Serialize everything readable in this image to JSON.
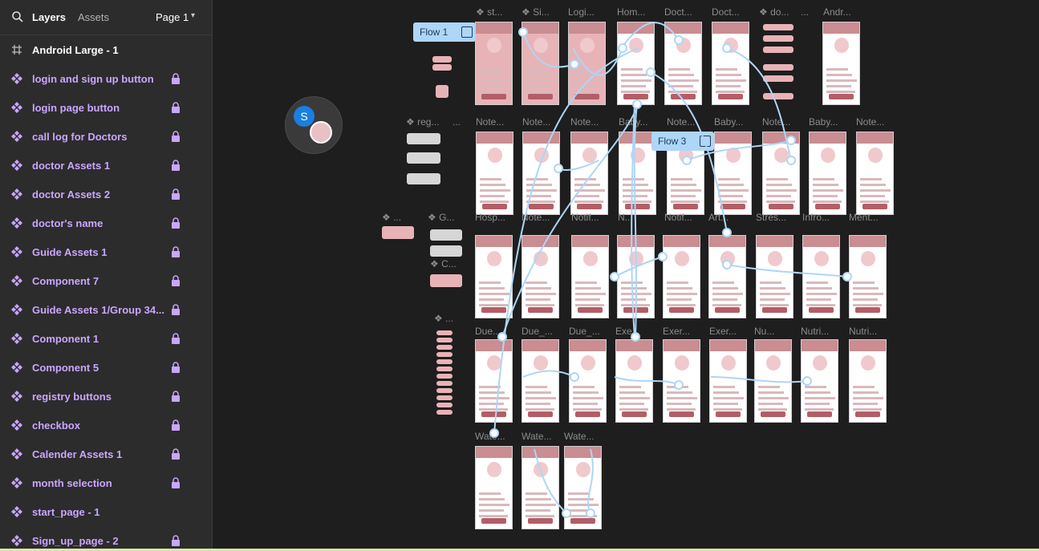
{
  "sidebar": {
    "tab_layers": "Layers",
    "tab_assets": "Assets",
    "page_selector": "Page 1",
    "frame_name": "Android Large - 1",
    "layers": [
      "login and sign up button",
      "login page button",
      "call log for Doctors",
      "doctor Assets 1",
      "doctor Assets 2",
      "doctor's name",
      "Guide Assets 1",
      "Component 7",
      "Guide Assets 1/Group 34...",
      "Component 1",
      "Component 5",
      "registry buttons",
      "checkbox",
      "Calender Assets 1",
      "month selection",
      "start_page - 1",
      "Sign_up_page - 2"
    ],
    "locked": [
      true,
      true,
      true,
      true,
      true,
      true,
      true,
      true,
      true,
      true,
      true,
      true,
      true,
      true,
      true,
      false,
      true
    ],
    "icons": {
      "frame": "frame-hash-icon",
      "component": "component-diamond-icon",
      "lock": "lock-icon",
      "search": "search-icon"
    }
  },
  "canvas": {
    "avatar_initial": "S",
    "flows": [
      "Flow 1",
      "Flow 3"
    ],
    "row_labels": {
      "r1": [
        "❖ st...",
        "❖ Si...",
        "Logi...",
        "Hom...",
        "Doct...",
        "Doct...",
        "❖ do...",
        "...",
        "Andr..."
      ],
      "r2": [
        "❖ reg...",
        "...",
        "Note...",
        "Note...",
        "Note...",
        "Baby...",
        "Note...",
        "Baby...",
        "Note...",
        "Baby...",
        "Note..."
      ],
      "r3": [
        "❖ ...",
        "❖ G...",
        "❖ C...",
        "Hosp...",
        "Note...",
        "Notif...",
        "N...",
        "Notif...",
        "Art...",
        "Stres...",
        "Infro...",
        "Ment..."
      ],
      "r4": [
        "❖ ...",
        "Due...",
        "Due_...",
        "Due_...",
        "Exe...",
        "Exer...",
        "Exer...",
        "Nu...",
        "Nutri...",
        "Nutri..."
      ],
      "r5": [
        "Wate...",
        "Wate...",
        "Wate..."
      ]
    }
  },
  "colors": {
    "sidebar_bg": "#2c2c2c",
    "canvas_bg": "#1e1e1e",
    "component_purple": "#c9a6ff",
    "flow_blue": "#aed6f7",
    "screen_pink": "#c98d92"
  }
}
